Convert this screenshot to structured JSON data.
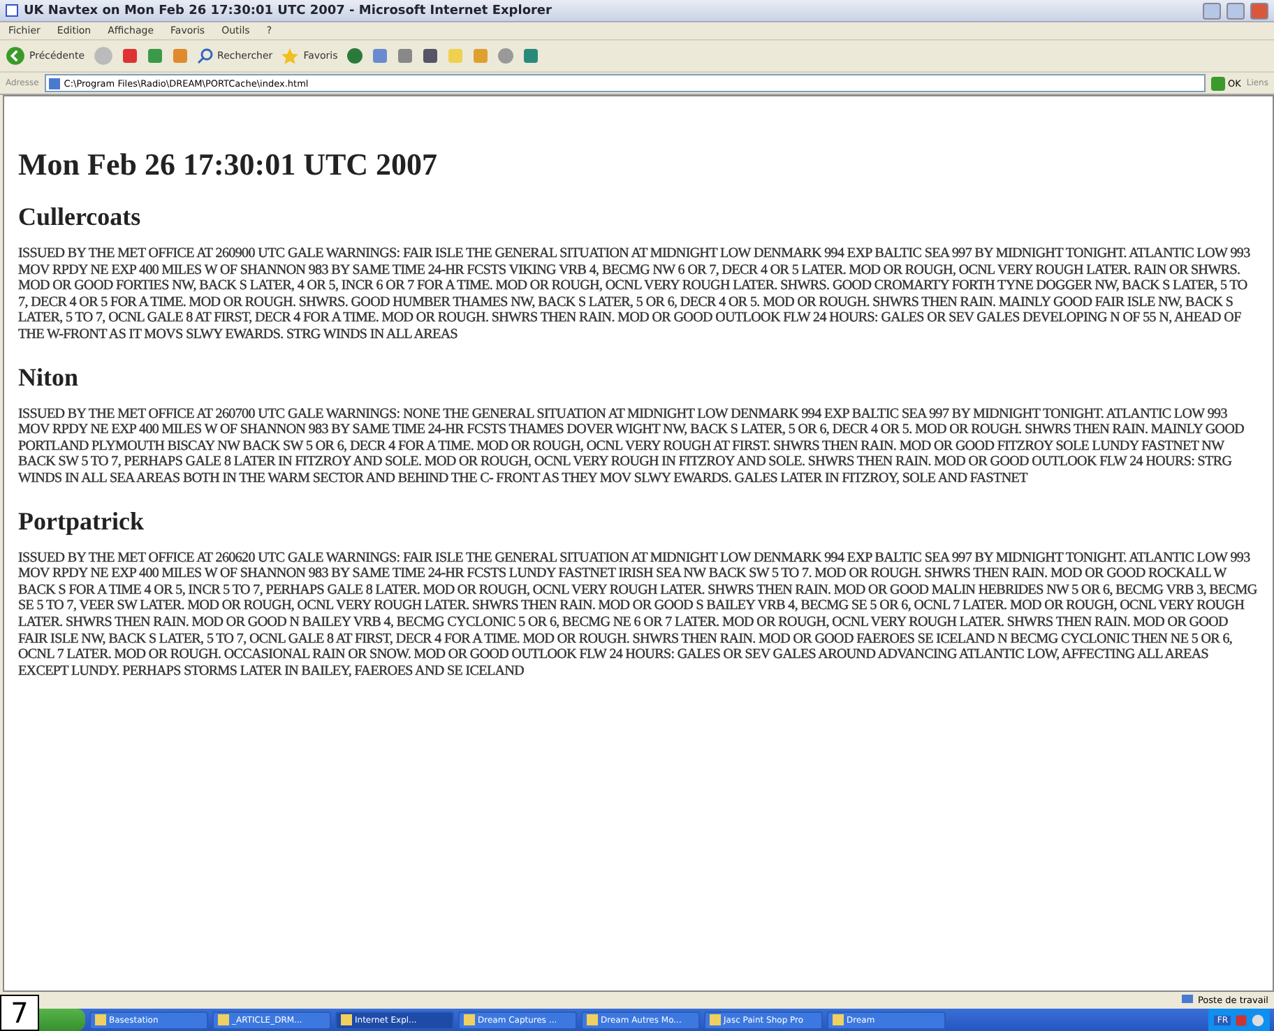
{
  "window": {
    "title": "UK Navtex on Mon Feb 26 17:30:01 UTC 2007 - Microsoft Internet Explorer"
  },
  "menu": [
    "Fichier",
    "Edition",
    "Affichage",
    "Favoris",
    "Outils",
    "?"
  ],
  "toolbar": {
    "back": "Précédente",
    "search": "Rechercher",
    "favorites": "Favoris"
  },
  "address_bar": {
    "label": "Adresse",
    "value": "C:\\Program Files\\Radio\\DREAM\\PORTCache\\index.html",
    "go": "OK",
    "links": "Liens"
  },
  "page": {
    "heading": "Mon Feb 26 17:30:01 UTC 2007",
    "sections": [
      {
        "title": "Cullercoats",
        "text": "ISSUED BY THE MET OFFICE AT 260900 UTC GALE WARNINGS: FAIR ISLE THE GENERAL SITUATION AT MIDNIGHT LOW DENMARK 994 EXP BALTIC SEA 997 BY MIDNIGHT TONIGHT. ATLANTIC LOW 993 MOV RPDY NE EXP 400 MILES W OF SHANNON 983 BY SAME TIME 24-HR FCSTS VIKING VRB 4, BECMG NW 6 OR 7, DECR 4 OR 5 LATER. MOD OR ROUGH, OCNL VERY ROUGH LATER. RAIN OR SHWRS. MOD OR GOOD FORTIES NW, BACK S LATER, 4 OR 5, INCR 6 OR 7 FOR A TIME. MOD OR ROUGH, OCNL VERY ROUGH LATER. SHWRS. GOOD CROMARTY FORTH TYNE DOGGER NW, BACK S LATER, 5 TO 7, DECR 4 OR 5 FOR A TIME. MOD OR ROUGH. SHWRS. GOOD HUMBER THAMES NW, BACK S LATER, 5 OR 6, DECR 4 OR 5. MOD OR ROUGH. SHWRS THEN RAIN. MAINLY GOOD FAIR ISLE NW, BACK S LATER, 5 TO 7, OCNL GALE 8 AT FIRST, DECR 4 FOR A TIME. MOD OR ROUGH. SHWRS THEN RAIN. MOD OR GOOD OUTLOOK FLW 24 HOURS: GALES OR SEV GALES DEVELOPING N OF 55 N, AHEAD OF THE W-FRONT AS IT MOVS SLWY EWARDS. STRG WINDS IN ALL AREAS"
      },
      {
        "title": "Niton",
        "text": "ISSUED BY THE MET OFFICE AT 260700 UTC GALE WARNINGS: NONE THE GENERAL SITUATION AT MIDNIGHT LOW DENMARK 994 EXP BALTIC SEA 997 BY MIDNIGHT TONIGHT. ATLANTIC LOW 993 MOV RPDY NE EXP 400 MILES W OF SHANNON 983 BY SAME TIME 24-HR FCSTS THAMES DOVER WIGHT NW, BACK S LATER, 5 OR 6, DECR 4 OR 5. MOD OR ROUGH. SHWRS THEN RAIN. MAINLY GOOD PORTLAND PLYMOUTH BISCAY NW BACK SW 5 OR 6, DECR 4 FOR A TIME. MOD OR ROUGH, OCNL VERY ROUGH AT FIRST. SHWRS THEN RAIN. MOD OR GOOD FITZROY SOLE LUNDY FASTNET NW BACK SW 5 TO 7, PERHAPS GALE 8 LATER IN FITZROY AND SOLE. MOD OR ROUGH, OCNL VERY ROUGH IN FITZROY AND SOLE. SHWRS THEN RAIN. MOD OR GOOD OUTLOOK FLW 24 HOURS: STRG WINDS IN ALL SEA AREAS BOTH IN THE WARM SECTOR AND BEHIND THE C- FRONT AS THEY MOV SLWY EWARDS. GALES LATER IN FITZROY, SOLE AND FASTNET"
      },
      {
        "title": "Portpatrick",
        "text": "ISSUED BY THE MET OFFICE AT 260620 UTC GALE WARNINGS: FAIR ISLE THE GENERAL SITUATION AT MIDNIGHT LOW DENMARK 994 EXP BALTIC SEA 997 BY MIDNIGHT TONIGHT. ATLANTIC LOW 993 MOV RPDY NE EXP 400 MILES W OF SHANNON 983 BY SAME TIME 24-HR FCSTS LUNDY FASTNET IRISH SEA NW BACK SW 5 TO 7. MOD OR ROUGH. SHWRS THEN RAIN. MOD OR GOOD ROCKALL W BACK S FOR A TIME 4 OR 5, INCR 5 TO 7, PERHAPS GALE 8 LATER. MOD OR ROUGH, OCNL VERY ROUGH LATER. SHWRS THEN RAIN. MOD OR GOOD MALIN HEBRIDES NW 5 OR 6, BECMG VRB 3, BECMG SE 5 TO 7, VEER SW LATER. MOD OR ROUGH, OCNL VERY ROUGH LATER. SHWRS THEN RAIN. MOD OR GOOD S BAILEY VRB 4, BECMG SE 5 OR 6, OCNL 7 LATER. MOD OR ROUGH, OCNL VERY ROUGH LATER. SHWRS THEN RAIN. MOD OR GOOD N BAILEY VRB 4, BECMG CYCLONIC 5 OR 6, BECMG NE 6 OR 7 LATER. MOD OR ROUGH, OCNL VERY ROUGH LATER. SHWRS THEN RAIN. MOD OR GOOD FAIR ISLE NW, BACK S LATER, 5 TO 7, OCNL GALE 8 AT FIRST, DECR 4 FOR A TIME. MOD OR ROUGH. SHWRS THEN RAIN. MOD OR GOOD FAEROES SE ICELAND N BECMG CYCLONIC THEN NE 5 OR 6, OCNL 7 LATER. MOD OR ROUGH. OCCASIONAL RAIN OR SNOW. MOD OR GOOD OUTLOOK FLW 24 HOURS: GALES OR SEV GALES AROUND ADVANCING ATLANTIC LOW, AFFECTING ALL AREAS EXCEPT LUNDY. PERHAPS STORMS LATER IN BAILEY, FAEROES AND SE ICELAND"
      }
    ]
  },
  "status_bar": {
    "zone": "Poste de travail"
  },
  "taskbar": {
    "items": [
      {
        "label": "Basestation",
        "selected": false
      },
      {
        "label": "_ARTICLE_DRM...",
        "selected": false
      },
      {
        "label": "Internet Expl...",
        "selected": true
      },
      {
        "label": "Dream Captures ...",
        "selected": false
      },
      {
        "label": "Dream Autres Mo...",
        "selected": false
      },
      {
        "label": "Jasc Paint Shop Pro",
        "selected": false
      },
      {
        "label": "Dream",
        "selected": false
      }
    ],
    "language": "FR"
  },
  "figure_number": "7"
}
